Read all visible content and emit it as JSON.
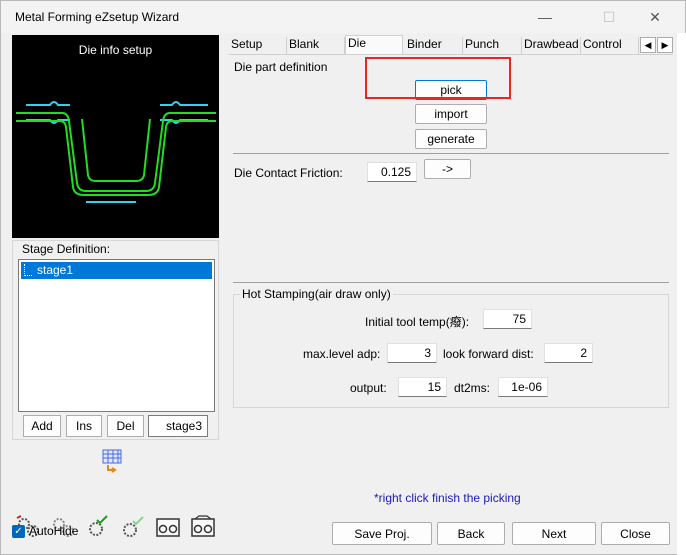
{
  "window": {
    "title": "Metal Forming eZsetup Wizard",
    "minimize": "—",
    "maximize": "☐",
    "close": "✕"
  },
  "preview": {
    "title": "Die info setup",
    "colors": {
      "die": "#22dd22",
      "blank": "#33d0f0",
      "background": "#000000"
    }
  },
  "stage": {
    "label": "Stage Definition:",
    "items": [
      "stage1"
    ],
    "buttons": {
      "add": "Add",
      "ins": "Ins",
      "del": "Del"
    },
    "name_field": "stage3"
  },
  "autohide": {
    "label": "AutoHide",
    "checked": true,
    "mark": "✓"
  },
  "tabs": [
    {
      "label": "Setup"
    },
    {
      "label": "Blank"
    },
    {
      "label": "Die"
    },
    {
      "label": "Binder"
    },
    {
      "label": "Punch"
    },
    {
      "label": "Drawbead"
    },
    {
      "label": "Control"
    }
  ],
  "tab_scroll": {
    "left": "◀",
    "right": "▶"
  },
  "active_tab": "Die",
  "die": {
    "part_definition_label": "Die part definition",
    "pick_button": "pick",
    "import_button": "import",
    "generate_button": "generate",
    "contact_friction_label": "Die Contact Friction:",
    "contact_friction_value": "0.125",
    "arrow_button": "->"
  },
  "hot_stamping": {
    "group_label": "Hot Stamping(air draw only)",
    "initial_tool_temp_label": "Initial tool temp(癈):",
    "initial_tool_temp_value": "75",
    "max_level_adp_label": "max.level adp:",
    "max_level_adp_value": "3",
    "look_forward_dist_label": "look forward dist:",
    "look_forward_dist_value": "2",
    "output_label": "output:",
    "output_value": "15",
    "dt2ms_label": "dt2ms:",
    "dt2ms_value": "1e-06"
  },
  "hint": "*right click finish the picking",
  "footer": {
    "save": "Save Proj.",
    "back": "Back",
    "next": "Next",
    "close": "Close"
  },
  "colors": {
    "highlight": "#e8281e",
    "selection": "#0078d7",
    "hint": "#1a1ab8"
  }
}
